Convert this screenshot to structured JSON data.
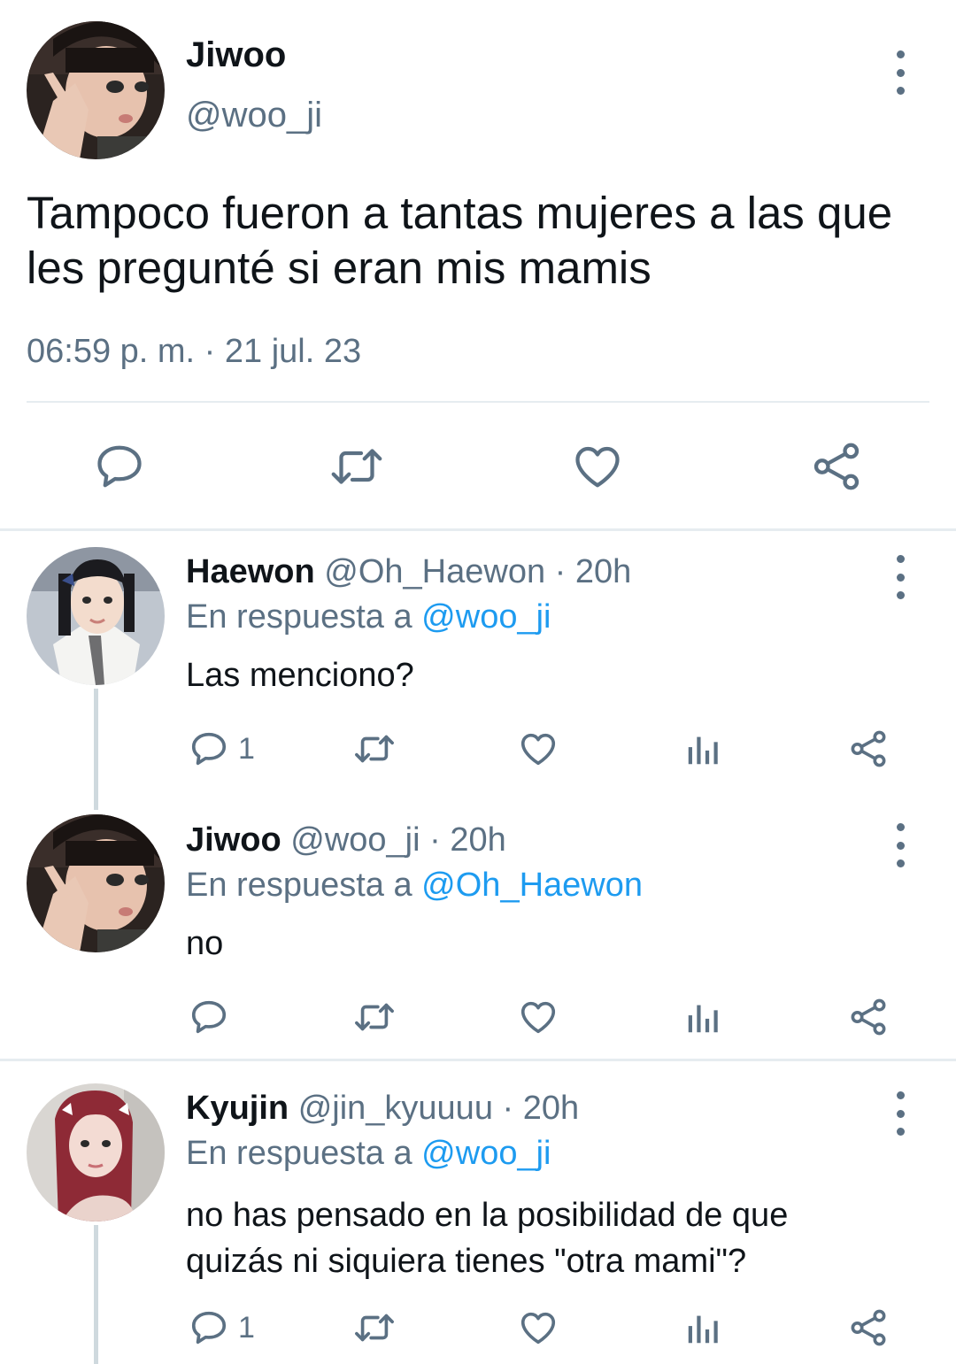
{
  "main_tweet": {
    "name": "Jiwoo",
    "handle": "@woo_ji",
    "text_line1": "Tampoco fueron a tantas mujeres a las que",
    "text_line2": "les pregunté si eran mis mamis",
    "timestamp": "06:59 p. m. · 21 jul. 23"
  },
  "replies": [
    {
      "name": "Haewon",
      "handle": "@Oh_Haewon",
      "time": "· 20h",
      "reply_prefix": "En respuesta a",
      "reply_to": "@woo_ji",
      "text_line1": "Las menciono?",
      "text_line2": "",
      "reply_count": "1"
    },
    {
      "name": "Jiwoo",
      "handle": "@woo_ji",
      "time": "· 20h",
      "reply_prefix": "En respuesta a",
      "reply_to": "@Oh_Haewon",
      "text_line1": "no",
      "text_line2": "",
      "reply_count": ""
    },
    {
      "name": "Kyujin",
      "handle": "@jin_kyuuuu",
      "time": "· 20h",
      "reply_prefix": "En respuesta a",
      "reply_to": "@woo_ji",
      "text_line1": "no has pensado en la posibilidad de que",
      "text_line2": "quizás ni siquiera tienes \"otra mami\"?",
      "reply_count": "1"
    }
  ],
  "icons": [
    "more-icon",
    "reply-icon",
    "retweet-icon",
    "like-icon",
    "share-icon",
    "views-icon"
  ],
  "colors": {
    "link": "#1d9bf0",
    "muted": "#5b7083",
    "text": "#0f1419"
  }
}
